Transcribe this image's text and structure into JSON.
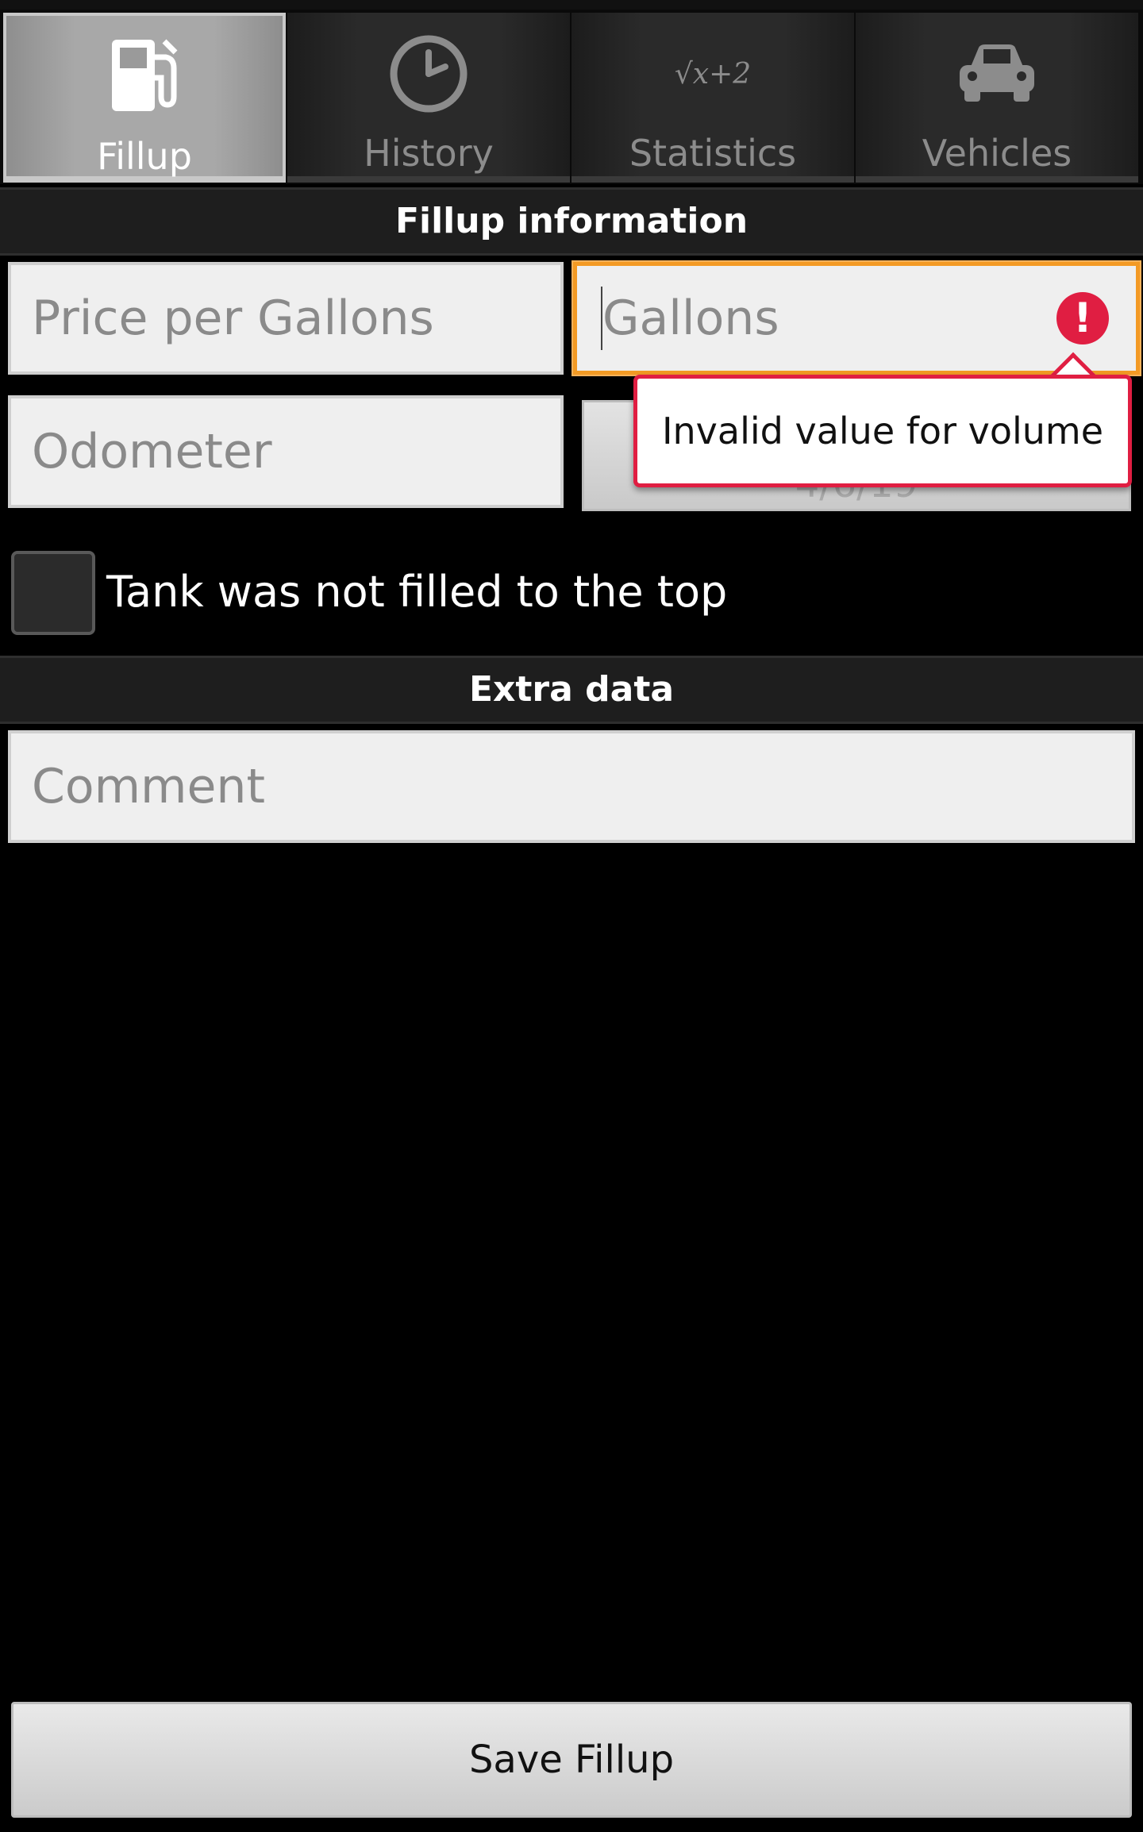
{
  "tabs": [
    {
      "label": "Fillup",
      "icon": "fuel-pump-icon",
      "active": true
    },
    {
      "label": "History",
      "icon": "clock-icon",
      "active": false
    },
    {
      "label": "Statistics",
      "icon": "formula-icon",
      "icon_text": "√x+2",
      "active": false
    },
    {
      "label": "Vehicles",
      "icon": "car-icon",
      "active": false
    }
  ],
  "sections": {
    "fillup_info": "Fillup information",
    "extra_data": "Extra data"
  },
  "form": {
    "price_placeholder": "Price per Gallons",
    "gallons_placeholder": "Gallons",
    "odometer_placeholder": "Odometer",
    "date_value": "4/6/19",
    "not_full_label": "Tank was not filled to the top",
    "comment_placeholder": "Comment"
  },
  "error": {
    "message": "Invalid value for volume",
    "icon_text": "!"
  },
  "actions": {
    "save_label": "Save Fillup"
  },
  "colors": {
    "focus_border": "#f39a24",
    "error": "#e01e42"
  }
}
